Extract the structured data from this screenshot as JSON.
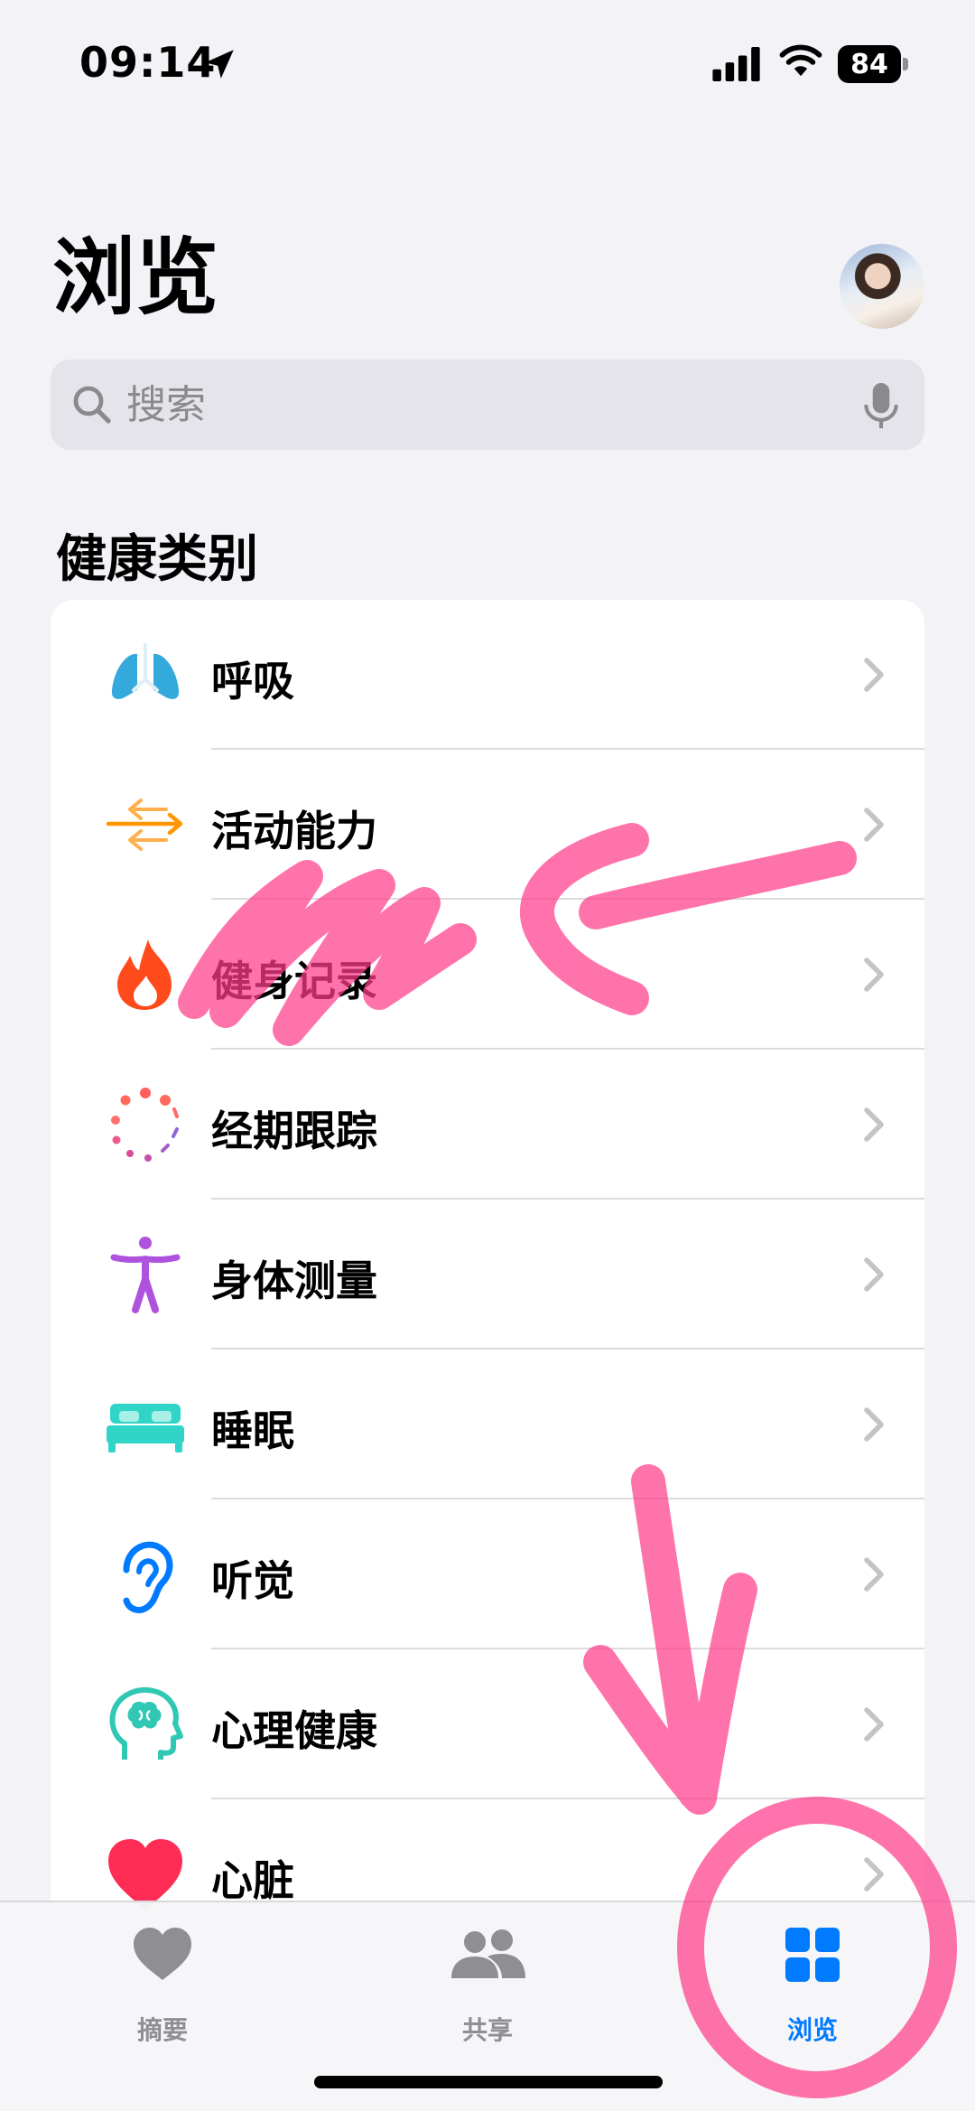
{
  "status_bar": {
    "time": "09:14",
    "battery_level": "84"
  },
  "header": {
    "title": "浏览",
    "avatar_icon": "user-avatar-photo"
  },
  "search": {
    "placeholder": "搜索"
  },
  "section": {
    "title": "健康类别"
  },
  "categories": [
    {
      "label": "呼吸",
      "icon": "lungs-icon",
      "color": "#34aadc"
    },
    {
      "label": "活动能力",
      "icon": "arrows-left-right-icon",
      "color": "#ff9500"
    },
    {
      "label": "健身记录",
      "icon": "flame-icon",
      "color": "#ff3b30"
    },
    {
      "label": "经期跟踪",
      "icon": "dotted-circle-icon",
      "color": "#ff2d55"
    },
    {
      "label": "身体测量",
      "icon": "figure-icon",
      "color": "#af52de"
    },
    {
      "label": "睡眠",
      "icon": "bed-icon",
      "color": "#30d5c8"
    },
    {
      "label": "听觉",
      "icon": "ear-icon",
      "color": "#007aff"
    },
    {
      "label": "心理健康",
      "icon": "head-brain-icon",
      "color": "#30c8b4"
    },
    {
      "label": "心脏",
      "icon": "heart-icon",
      "color": "#ff2d55"
    }
  ],
  "tabs": [
    {
      "label": "摘要",
      "icon": "heart-icon",
      "active": false
    },
    {
      "label": "共享",
      "icon": "people-icon",
      "active": false
    },
    {
      "label": "浏览",
      "icon": "grid-icon",
      "active": true
    }
  ],
  "colors": {
    "accent": "#007aff",
    "background": "#f2f2f7",
    "marker": "#ff3d8b"
  }
}
